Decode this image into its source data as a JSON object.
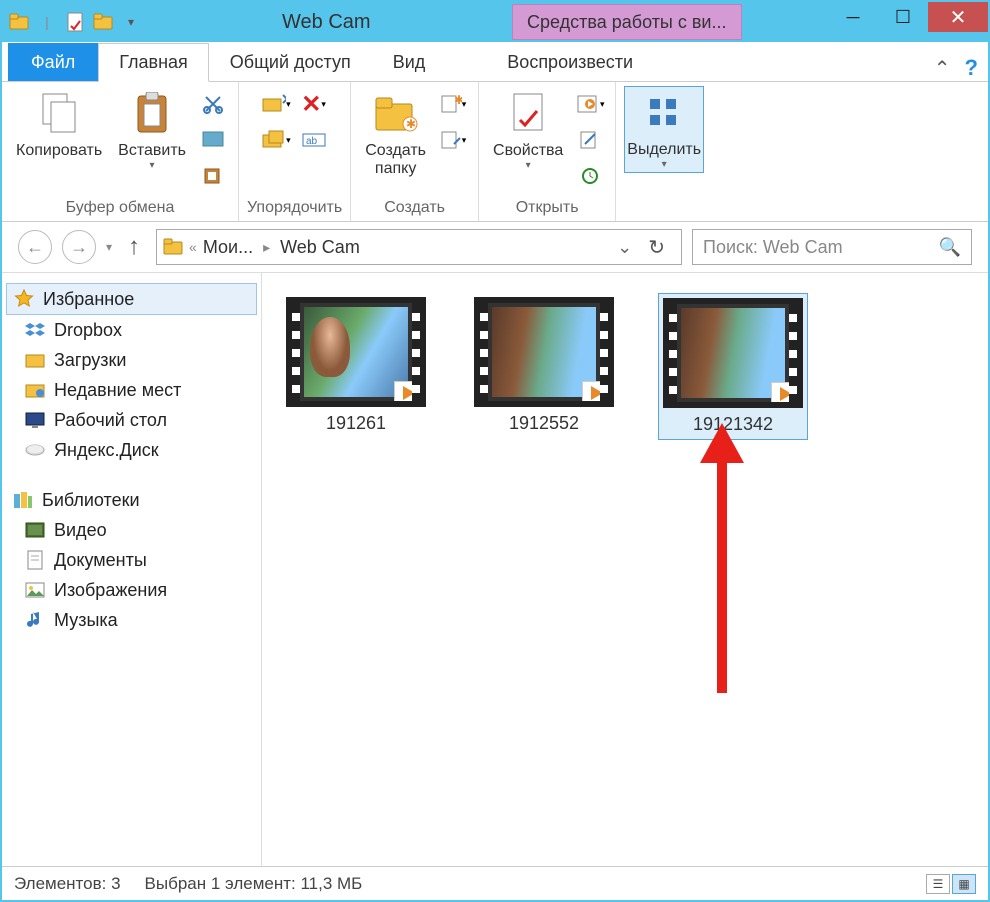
{
  "title": "Web Cam",
  "context_tab": "Средства работы с ви...",
  "tabs": {
    "file": "Файл",
    "home": "Главная",
    "share": "Общий доступ",
    "view": "Вид",
    "play": "Воспроизвести"
  },
  "ribbon": {
    "copy": "Копировать",
    "paste": "Вставить",
    "clipboard": "Буфер обмена",
    "organize": "Упорядочить",
    "newfolder": "Создать\nпапку",
    "create": "Создать",
    "properties": "Свойства",
    "open": "Открыть",
    "select": "Выделить"
  },
  "breadcrumb": {
    "seg1": "Мои...",
    "seg2": "Web Cam"
  },
  "search_placeholder": "Поиск: Web Cam",
  "sidebar": {
    "fav": "Избранное",
    "dropbox": "Dropbox",
    "downloads": "Загрузки",
    "recent": "Недавние мест",
    "desktop": "Рабочий стол",
    "yadisk": "Яндекс.Диск",
    "libraries": "Библиотеки",
    "video": "Видео",
    "documents": "Документы",
    "images": "Изображения",
    "music": "Музыка"
  },
  "files": [
    {
      "name": "191261"
    },
    {
      "name": "1912552"
    },
    {
      "name": "19121342"
    }
  ],
  "status": {
    "count": "Элементов: 3",
    "selected": "Выбран 1 элемент: 11,3 МБ"
  }
}
